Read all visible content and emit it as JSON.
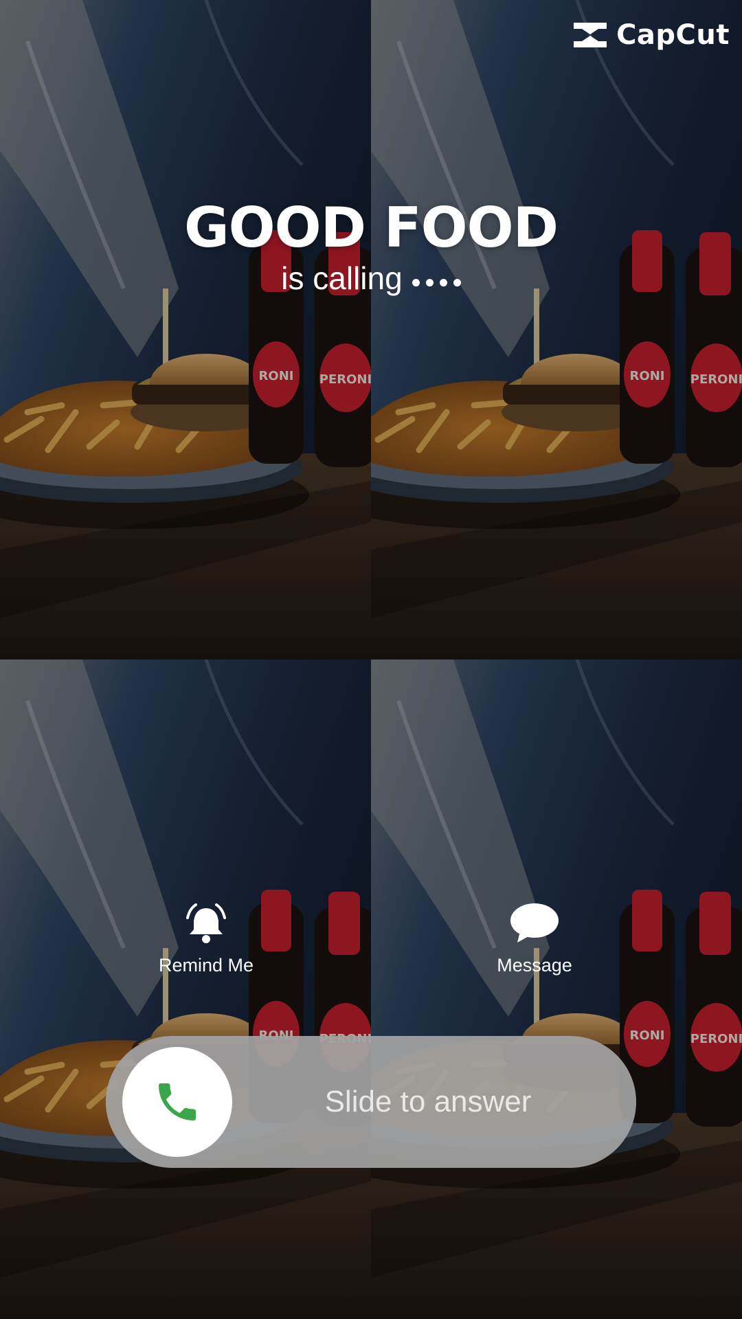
{
  "brand": {
    "name": "CapCut",
    "icon": "capcut-logo-icon"
  },
  "caller": {
    "name": "GOOD FOOD",
    "status": "is calling"
  },
  "actions": [
    {
      "label": "Remind Me",
      "icon": "bell-icon"
    },
    {
      "label": "Message",
      "icon": "chat-bubble-icon"
    }
  ],
  "slider": {
    "label": "Slide to answer",
    "icon": "phone-icon",
    "icon_color": "#3aa64a"
  },
  "bottles": {
    "label": "PERONI",
    "color": "#c41f2e"
  },
  "colors": {
    "text": "#ffffff",
    "slider_bg": "#a2a2a2",
    "wall": "#1e2d44",
    "table": "#3a2b21"
  }
}
